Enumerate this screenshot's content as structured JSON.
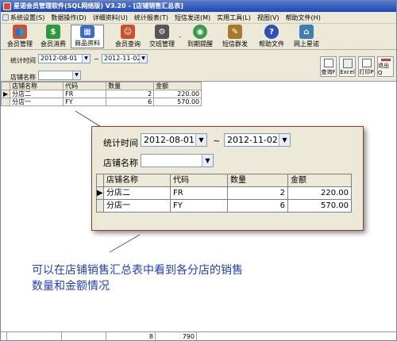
{
  "window": {
    "title": "星诺会员管理软件(SQL网络版) V3.20 - [店铺销售汇总表]"
  },
  "menu": [
    "系统设置(S)",
    "数据操作(D)",
    "详细资料(U)",
    "统计报表(T)",
    "短信发送(M)",
    "实用工具(L)",
    "视图(V)",
    "帮助文件(H)"
  ],
  "toolbar": [
    {
      "label": "会员管理",
      "icon": "members-icon",
      "color": "#c8542d"
    },
    {
      "label": "会员消费",
      "icon": "dollar-icon",
      "color": "#2a9a3c"
    },
    {
      "label": "商品资料",
      "icon": "building-icon",
      "color": "#3b6cc9"
    },
    {
      "label": "会员查询",
      "icon": "user-search-icon",
      "color": "#c8542d"
    },
    {
      "label": "交班管理",
      "icon": "handover-icon",
      "color": "#555555"
    },
    {
      "label": "到期提醒",
      "icon": "chrome-icon",
      "color": "#3d9a4a"
    },
    {
      "label": "短信群发",
      "icon": "pencil-icon",
      "color": "#a57b2b"
    },
    {
      "label": "帮助文件",
      "icon": "help-icon",
      "color": "#2d4fb8"
    },
    {
      "label": "网上星诺",
      "icon": "network-icon",
      "color": "#3b7fb5"
    }
  ],
  "filter": {
    "date_label": "统计时间",
    "date_from": "2012-08-01",
    "tilde": "~",
    "date_to": "2012-11-02",
    "shop_label": "店铺名称",
    "shop_value": ""
  },
  "right_buttons": [
    "查询F",
    "Excel",
    "打印P",
    "退出Q"
  ],
  "table": {
    "headers": [
      "店铺名称",
      "代码",
      "数量",
      "金额"
    ],
    "rows": [
      {
        "name": "分店二",
        "code": "FR",
        "qty": "2",
        "amount": "220.00"
      },
      {
        "name": "分店一",
        "code": "FY",
        "qty": "6",
        "amount": "570.00"
      }
    ],
    "footer": {
      "qty": "8",
      "amount": "790"
    }
  },
  "caption": {
    "line1": "可以在店铺销售汇总表中看到各分店的销售",
    "line2": "数量和金额情况"
  }
}
